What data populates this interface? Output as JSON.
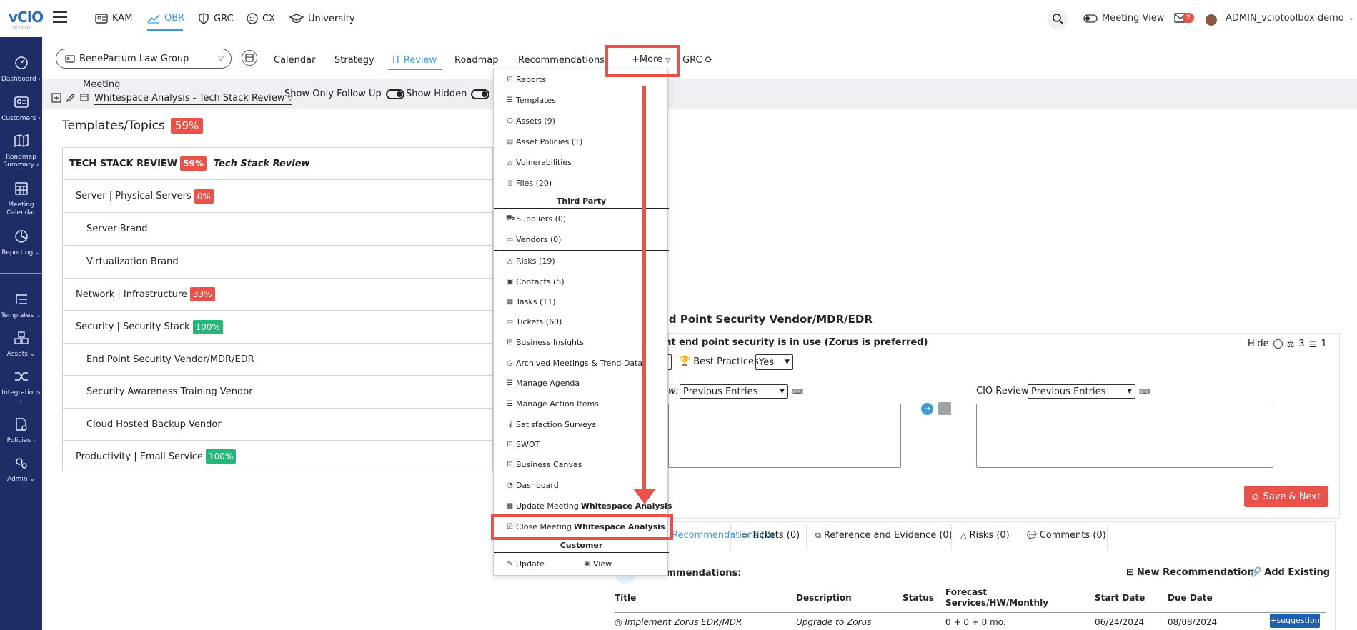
{
  "app": {
    "logo_text": "vCIO",
    "logo_sub": "TOOLBOX",
    "accent_color": "#3b9bd6",
    "sidebar_color": "#1f2d66",
    "danger_color": "#e8524a",
    "success_color": "#26b57a"
  },
  "sidebar": {
    "items": [
      {
        "label": "Dashboard",
        "icon": "speedometer-icon"
      },
      {
        "label": "Customers",
        "icon": "id-card-icon"
      },
      {
        "label": "Roadmap Summary",
        "icon": "map-icon"
      },
      {
        "label": "Meeting Calendar",
        "icon": "calendar-grid-icon"
      },
      {
        "label": "Reporting",
        "icon": "pie-chart-icon"
      },
      {
        "label": "Templates",
        "icon": "tree-list-icon"
      },
      {
        "label": "Assets",
        "icon": "cubes-icon"
      },
      {
        "label": "Integrations",
        "icon": "shuffle-icon"
      },
      {
        "label": "Policies",
        "icon": "document-gear-icon"
      },
      {
        "label": "Admin",
        "icon": "gears-icon"
      }
    ]
  },
  "topnav": {
    "items": [
      {
        "label": "KAM",
        "icon": "id-card-icon"
      },
      {
        "label": "QBR",
        "icon": "trend-chart-icon"
      },
      {
        "label": "GRC",
        "icon": "shield-icon"
      },
      {
        "label": "CX",
        "icon": "smiley-icon"
      },
      {
        "label": "University",
        "icon": "graduation-cap-icon"
      }
    ],
    "meeting_view_label": "Meeting View",
    "mail_badge": "2",
    "user_label": "ADMIN_vciotoolbox demo"
  },
  "subnav": {
    "customer": "BenePartum Law Group",
    "tabs": [
      "Calendar",
      "Strategy",
      "IT Review",
      "Roadmap",
      "Recommendations"
    ],
    "active_tab": "IT Review",
    "more_label": "+More",
    "grc_label": "GRC"
  },
  "meeting": {
    "label": "Meeting",
    "value": "Whitespace Analysis - Tech Stack Review",
    "show_follow_up": "Show Only Follow Up",
    "show_hidden": "Show Hidden"
  },
  "templates": {
    "title": "Templates/Topics",
    "percent": "59%",
    "header_name": "TECH STACK REVIEW",
    "header_pct": "59%",
    "header_sub": "Tech Stack Review",
    "rows": [
      {
        "label": "Server | Physical Servers",
        "pct": "0%",
        "pct_color": "red",
        "indent": 1
      },
      {
        "label": "Server Brand",
        "pct": "",
        "indent": 2
      },
      {
        "label": "Virtualization Brand",
        "pct": "",
        "indent": 2
      },
      {
        "label": "Network | Infrastructure",
        "pct": "33%",
        "pct_color": "red",
        "indent": 1
      },
      {
        "label": "Security | Security Stack",
        "pct": "100%",
        "pct_color": "green",
        "indent": 1
      },
      {
        "label": "End Point Security Vendor/MDR/EDR",
        "pct": "",
        "indent": 2
      },
      {
        "label": "Security Awareness Training Vendor",
        "pct": "",
        "indent": 2
      },
      {
        "label": "Cloud Hosted Backup Vendor",
        "pct": "",
        "indent": 2
      },
      {
        "label": "Productivity | Email Service",
        "pct": "100%",
        "pct_color": "green",
        "indent": 1
      }
    ]
  },
  "more_menu": {
    "items_top": [
      {
        "label": "Reports",
        "icon": "grid-icon"
      },
      {
        "label": "Templates",
        "icon": "list-icon"
      },
      {
        "label": "Assets (9)",
        "icon": "cube-icon"
      },
      {
        "label": "Asset Policies (1)",
        "icon": "document-icon"
      },
      {
        "label": "Vulnerabilities",
        "icon": "warning-icon"
      },
      {
        "label": "Files (20)",
        "icon": "file-icon"
      }
    ],
    "third_party_heading": "Third Party",
    "items_third_party": [
      {
        "label": "Suppliers (0)",
        "icon": "truck-icon"
      },
      {
        "label": "Vendors (0)",
        "icon": "folder-icon"
      }
    ],
    "items_bottom": [
      {
        "label": "Risks (19)",
        "icon": "warning-icon"
      },
      {
        "label": "Contacts (5)",
        "icon": "contact-card-icon"
      },
      {
        "label": "Tasks (11)",
        "icon": "calendar-icon"
      },
      {
        "label": "Tickets (60)",
        "icon": "ticket-icon"
      },
      {
        "label": "Business Insights",
        "icon": "grid-icon"
      },
      {
        "label": "Archived Meetings & Trend Data",
        "icon": "clock-icon"
      },
      {
        "label": "Manage Agenda",
        "icon": "list-icon"
      },
      {
        "label": "Manage Action Items",
        "icon": "list-icon"
      },
      {
        "label": "Satisfaction Surveys",
        "icon": "thermometer-icon"
      },
      {
        "label": "SWOT",
        "icon": "grid-icon"
      },
      {
        "label": "Business Canvas",
        "icon": "grid-icon"
      },
      {
        "label": "Dashboard",
        "icon": "speedometer-icon"
      }
    ],
    "update_meeting_label": "Update Meeting",
    "update_meeting_name": "Whitespace Analysis",
    "close_meeting_label": "Close Meeting",
    "close_meeting_name": "Whitespace Analysis",
    "customer_heading": "Customer",
    "customer_update": "Update",
    "customer_view": "View"
  },
  "detail": {
    "title": "End Point Security Vendor/MDR/EDR",
    "question": "What end point security is in use (Zorus is preferred)",
    "hide_label": "Hide",
    "count_a": "3",
    "count_b": "1",
    "best_practices_label": "Best Practices:",
    "best_practices_value": "Yes",
    "review_left_label": "Technical Review:",
    "review_left_value": "Previous Entries",
    "review_right_label": "CIO Review",
    "review_right_value": "Previous Entries",
    "save_next": "Save & Next"
  },
  "bottom_tabs": {
    "tabs": [
      {
        "label": "Recommendations (0)",
        "icon": "lightbulb-icon"
      },
      {
        "label": "Tickets (0)",
        "icon": "ticket-icon"
      },
      {
        "label": "Reference and Evidence (0)",
        "icon": "external-link-icon"
      },
      {
        "label": "Risks (0)",
        "icon": "warning-icon"
      },
      {
        "label": "Comments (0)",
        "icon": "comments-icon"
      }
    ],
    "recs_title": "Recommendations:",
    "new_rec": "New Recommendation",
    "add_existing": "Add Existing",
    "columns": [
      "Title",
      "Description",
      "Status",
      "Forecast Services/HW/Monthly",
      "Start Date",
      "Due Date"
    ],
    "row": {
      "title": "Implement Zorus EDR/MDR",
      "description": "Upgrade to Zorus",
      "status": "",
      "forecast": "0 + 0 + 0 mo.",
      "start": "06/24/2024",
      "due": "08/08/2024",
      "action": "+suggestion"
    }
  }
}
